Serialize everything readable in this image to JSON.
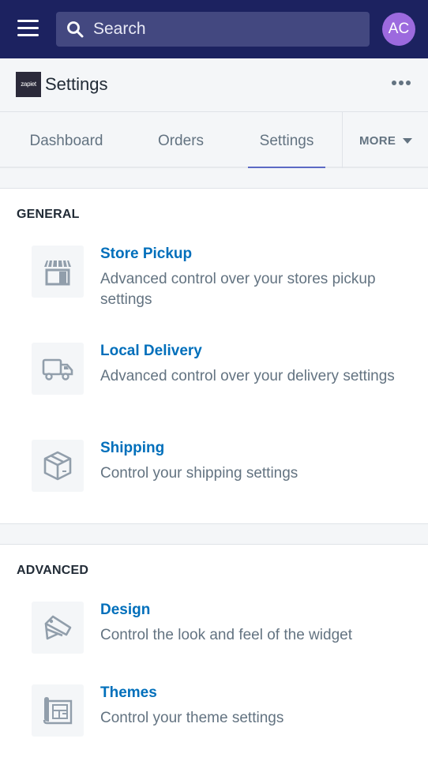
{
  "topbar": {
    "menu_icon": "hamburger-icon",
    "search": {
      "placeholder": "Search",
      "value": "",
      "icon": "search-icon"
    },
    "avatar": {
      "initials": "AC",
      "color": "#9c6ade"
    },
    "background": "#1c2260"
  },
  "titlebar": {
    "app_logo_text": "zapiet",
    "title": "Settings",
    "more_icon": "ellipsis-icon"
  },
  "tabs": {
    "items": [
      {
        "label": "Dashboard",
        "active": false
      },
      {
        "label": "Orders",
        "active": false
      },
      {
        "label": "Settings",
        "active": true
      }
    ],
    "more_label": "MORE",
    "accent": "#5c6ac4"
  },
  "sections": [
    {
      "title": "GENERAL",
      "items": [
        {
          "icon": "storefront-icon",
          "title": "Store Pickup",
          "description": "Advanced control over your stores pickup settings"
        },
        {
          "icon": "delivery-truck-icon",
          "title": "Local Delivery",
          "description": "Advanced control over your delivery settings"
        },
        {
          "icon": "package-box-icon",
          "title": "Shipping",
          "description": "Control your shipping settings"
        }
      ]
    },
    {
      "title": "ADVANCED",
      "items": [
        {
          "icon": "color-swatch-icon",
          "title": "Design",
          "description": "Control the look and feel of the widget"
        },
        {
          "icon": "blueprint-icon",
          "title": "Themes",
          "description": "Control your theme settings"
        }
      ]
    }
  ],
  "colors": {
    "link": "#006fbb",
    "muted": "#637381",
    "text": "#212b36"
  }
}
